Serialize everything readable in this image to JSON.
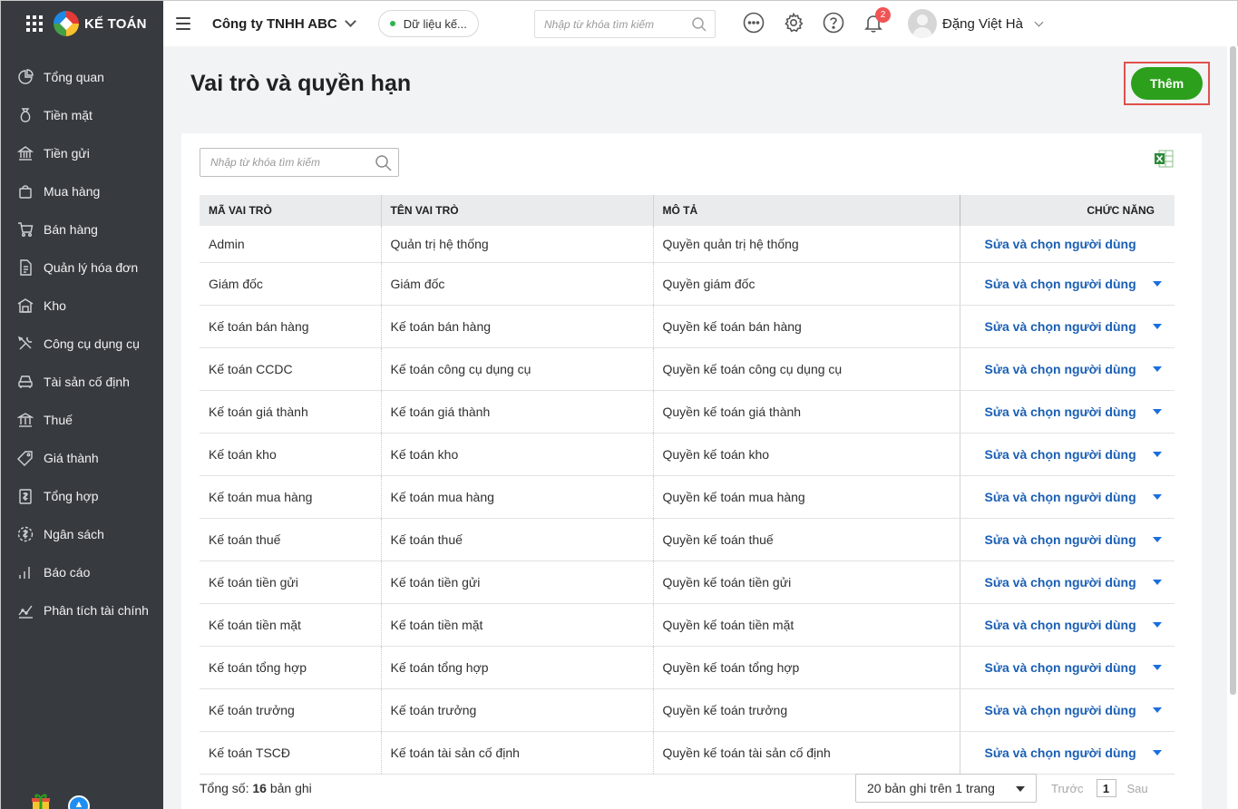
{
  "brand": {
    "logo_text": "KẾ TOÁN"
  },
  "sidebar": {
    "items": [
      {
        "label": "Tổng quan",
        "icon": "dashboard-icon"
      },
      {
        "label": "Tiền mặt",
        "icon": "money-bag-icon"
      },
      {
        "label": "Tiền gửi",
        "icon": "bank-icon"
      },
      {
        "label": "Mua hàng",
        "icon": "shopping-bag-icon"
      },
      {
        "label": "Bán hàng",
        "icon": "cart-icon"
      },
      {
        "label": "Quản lý hóa đơn",
        "icon": "invoice-icon"
      },
      {
        "label": "Kho",
        "icon": "warehouse-icon"
      },
      {
        "label": "Công cụ dụng cụ",
        "icon": "tools-icon"
      },
      {
        "label": "Tài sản cố định",
        "icon": "car-icon"
      },
      {
        "label": "Thuế",
        "icon": "tax-building-icon"
      },
      {
        "label": "Giá thành",
        "icon": "price-tag-icon"
      },
      {
        "label": "Tổng hợp",
        "icon": "ledger-icon"
      },
      {
        "label": "Ngân sách",
        "icon": "budget-icon"
      },
      {
        "label": "Báo cáo",
        "icon": "bar-chart-icon"
      },
      {
        "label": "Phân tích tài chính",
        "icon": "analytics-icon"
      }
    ]
  },
  "header": {
    "company": "Công ty TNHH ABC",
    "data_status": "Dữ liệu kế...",
    "search_placeholder": "Nhập từ khóa tìm kiếm",
    "notification_count": "2",
    "user_name": "Đặng Việt Hà"
  },
  "page": {
    "title": "Vai trò và quyền hạn",
    "add_button": "Thêm",
    "search_placeholder": "Nhập từ khóa tìm kiếm"
  },
  "table": {
    "columns": [
      "MÃ VAI TRÒ",
      "TÊN VAI TRÒ",
      "MÔ TẢ",
      "CHỨC NĂNG"
    ],
    "action_label": "Sửa và chọn người dùng",
    "rows": [
      {
        "code": "Admin",
        "name": "Quản trị hệ thống",
        "desc": "Quyền quản trị hệ thống"
      },
      {
        "code": "Giám đốc",
        "name": "Giám đốc",
        "desc": "Quyền giám đốc"
      },
      {
        "code": "Kế toán bán hàng",
        "name": "Kế toán bán hàng",
        "desc": "Quyền kế toán bán hàng"
      },
      {
        "code": "Kế toán CCDC",
        "name": "Kế toán công cụ dụng cụ",
        "desc": "Quyền kế toán công cụ dụng cụ"
      },
      {
        "code": "Kế toán giá thành",
        "name": "Kế toán giá thành",
        "desc": "Quyền kế toán giá thành"
      },
      {
        "code": "Kế toán kho",
        "name": "Kế toán kho",
        "desc": "Quyền kế toán kho"
      },
      {
        "code": "Kế toán mua hàng",
        "name": "Kế toán mua hàng",
        "desc": "Quyền kế toán mua hàng"
      },
      {
        "code": "Kế toán thuế",
        "name": "Kế toán thuế",
        "desc": "Quyền kế toán thuế"
      },
      {
        "code": "Kế toán tiền gửi",
        "name": "Kế toán tiền gửi",
        "desc": "Quyền kế toán tiền gửi"
      },
      {
        "code": "Kế toán tiền mặt",
        "name": "Kế toán tiền mặt",
        "desc": "Quyền kế toán tiền mặt"
      },
      {
        "code": "Kế toán tổng hợp",
        "name": "Kế toán tổng hợp",
        "desc": "Quyền kế toán tổng hợp"
      },
      {
        "code": "Kế toán trưởng",
        "name": "Kế toán trưởng",
        "desc": "Quyền kế toán trưởng"
      },
      {
        "code": "Kế toán TSCĐ",
        "name": "Kế toán tài sản cố định",
        "desc": "Quyền kế toán tài sản cố định"
      }
    ]
  },
  "footer": {
    "total_prefix": "Tổng số: ",
    "total_count": "16",
    "total_suffix": " bản ghi",
    "per_page": "20 bản ghi trên 1 trang",
    "prev": "Trước",
    "page": "1",
    "next": "Sau"
  },
  "colors": {
    "sidebar_bg": "#373b40",
    "primary_green": "#2ca01c",
    "link_blue": "#1a5fb4",
    "highlight_red": "#e0514b"
  }
}
